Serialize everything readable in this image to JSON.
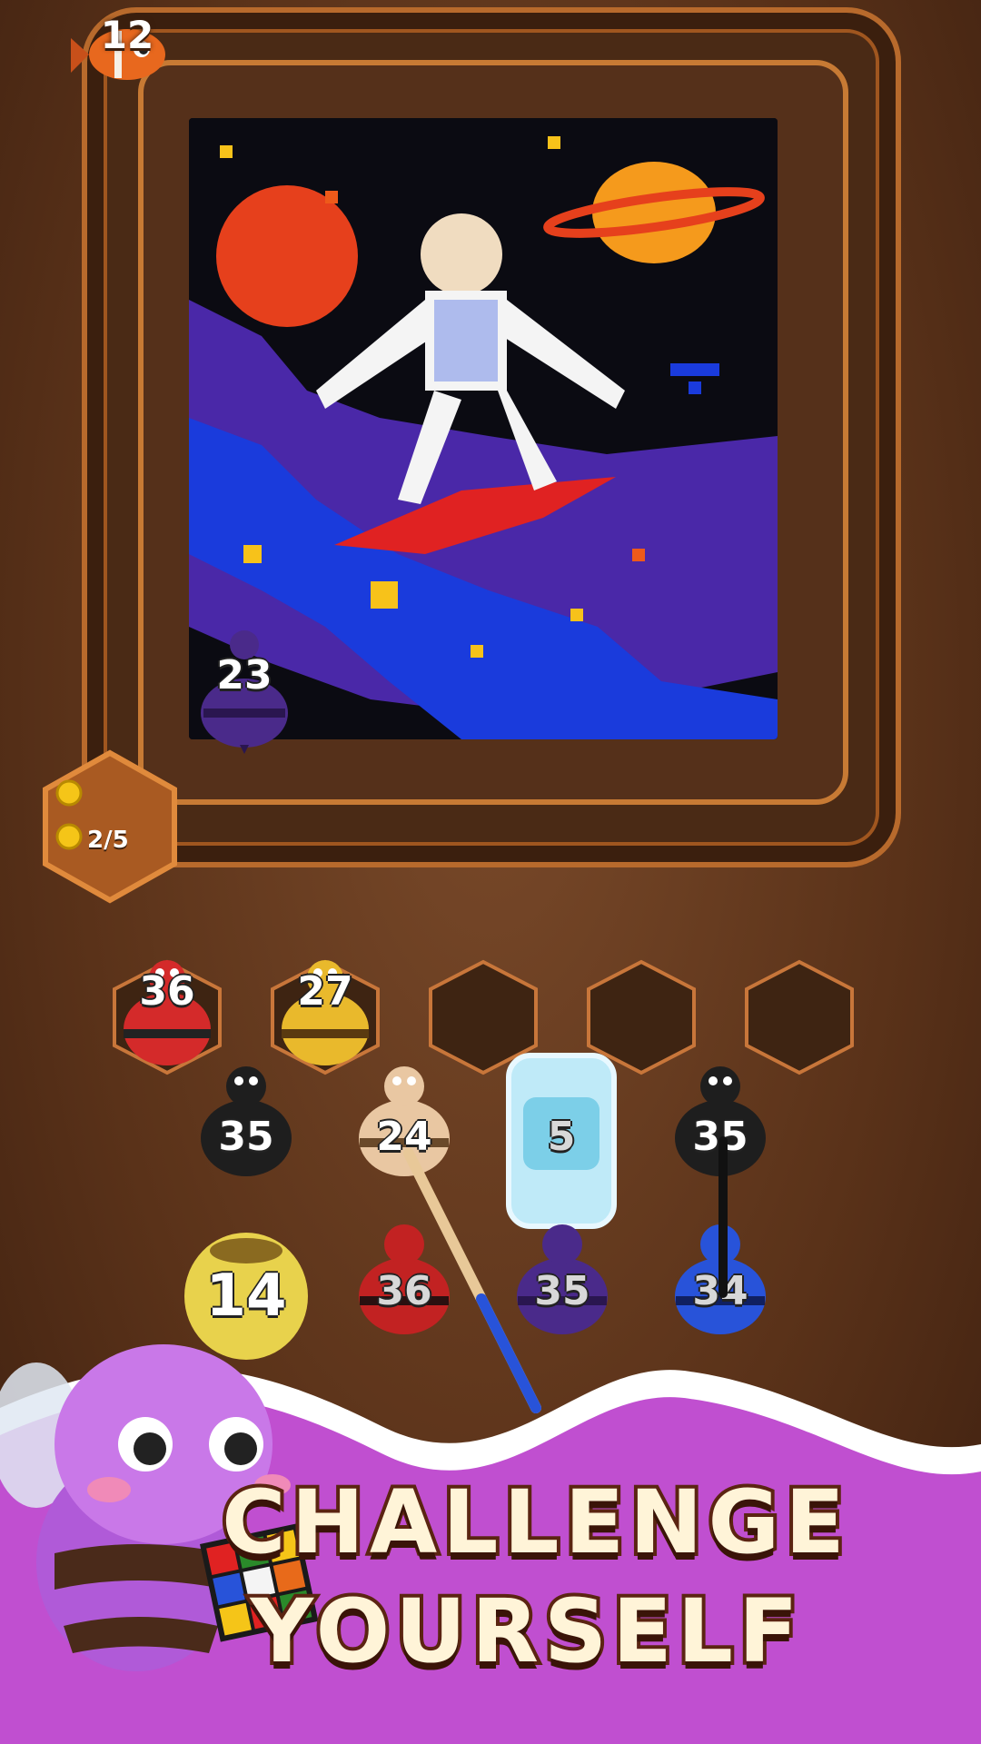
{
  "level": {
    "number": "12"
  },
  "coins": {
    "progress": "2/5"
  },
  "board": {
    "picture": "pixel-art astronaut surfing in space",
    "remaining_bee": {
      "count": "23",
      "color": "#4a2a8a"
    }
  },
  "slots": [
    {
      "bee": {
        "count": "36",
        "color": "#d42a2a"
      }
    },
    {
      "bee": {
        "count": "27",
        "color": "#e9b92c"
      }
    },
    {
      "bee": null
    },
    {
      "bee": null
    },
    {
      "bee": null
    }
  ],
  "queue": [
    {
      "count": "35",
      "color": "#1e1e1e"
    },
    {
      "count": "24",
      "color": "#e9c7a2"
    },
    {
      "count": "5",
      "color": "#9fdcf0",
      "frozen": true
    },
    {
      "count": "35",
      "color": "#1e1e1e"
    },
    {
      "count": "14",
      "color": "#e8d24c",
      "cocoon": true
    },
    {
      "count": "36",
      "color": "#c22222"
    },
    {
      "count": "35",
      "color": "#4a2a8a"
    },
    {
      "count": "34",
      "color": "#2853d9"
    }
  ],
  "banner": {
    "line1": "CHALLENGE",
    "line2": "YOURSELF",
    "mascot": "purple bee holding rubik cube"
  },
  "colors": {
    "frame": "#b86a2c",
    "banner": "#c04fd0",
    "background": "#5a3219"
  }
}
